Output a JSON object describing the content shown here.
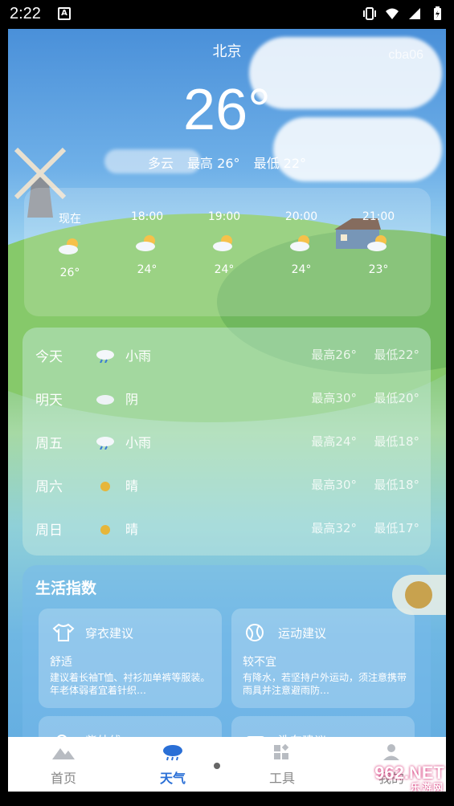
{
  "status_bar": {
    "time": "2:22",
    "notification_badge": "A"
  },
  "header": {
    "city": "北京",
    "watermark": "cba06",
    "temperature": "26°",
    "condition": "多云",
    "high": "最高 26°",
    "low": "最低 22°"
  },
  "hourly": [
    {
      "time": "现在",
      "icon": "partly-cloudy-icon",
      "temp": "26°"
    },
    {
      "time": "18:00",
      "icon": "partly-cloudy-icon",
      "temp": "24°"
    },
    {
      "time": "19:00",
      "icon": "partly-cloudy-icon",
      "temp": "24°"
    },
    {
      "time": "20:00",
      "icon": "partly-cloudy-icon",
      "temp": "24°"
    },
    {
      "time": "21:00",
      "icon": "partly-cloudy-icon",
      "temp": "23°"
    }
  ],
  "daily": [
    {
      "day": "今天",
      "icon": "light-rain-icon",
      "condition": "小雨",
      "high": "最高26°",
      "low": "最低22°"
    },
    {
      "day": "明天",
      "icon": "overcast-icon",
      "condition": "阴",
      "high": "最高30°",
      "low": "最低20°"
    },
    {
      "day": "周五",
      "icon": "light-rain-icon",
      "condition": "小雨",
      "high": "最高24°",
      "low": "最低18°"
    },
    {
      "day": "周六",
      "icon": "sunny-icon",
      "condition": "晴",
      "high": "最高30°",
      "low": "最低18°"
    },
    {
      "day": "周日",
      "icon": "sunny-icon",
      "condition": "晴",
      "high": "最高32°",
      "low": "最低17°"
    }
  ],
  "life": {
    "title": "生活指数",
    "cards": [
      {
        "title": "穿衣建议",
        "icon": "tshirt-icon",
        "value": "舒适",
        "desc": "建议着长袖T恤、衬衫加单裤等服装。年老体弱者宜着针织…"
      },
      {
        "title": "运动建议",
        "icon": "ball-icon",
        "value": "较不宜",
        "desc": "有降水，若坚持户外运动，须注意携带雨具并注意避雨防…"
      },
      {
        "title": "紫外线",
        "icon": "sun-icon"
      },
      {
        "title": "洗车建议",
        "icon": "car-icon"
      }
    ]
  },
  "tabs": [
    {
      "label": "首页",
      "icon": "mountain-icon"
    },
    {
      "label": "天气",
      "icon": "rain-cloud-icon"
    },
    {
      "label": "工具",
      "icon": "grid-icon"
    },
    {
      "label": "我的",
      "icon": "person-icon"
    }
  ],
  "corner_logo": {
    "main": "962.NET",
    "sub": "乐游网"
  },
  "colors": {
    "active_tab": "#2a6fd6",
    "sky_top": "#4a90d9",
    "grass": "#7cc36a"
  }
}
